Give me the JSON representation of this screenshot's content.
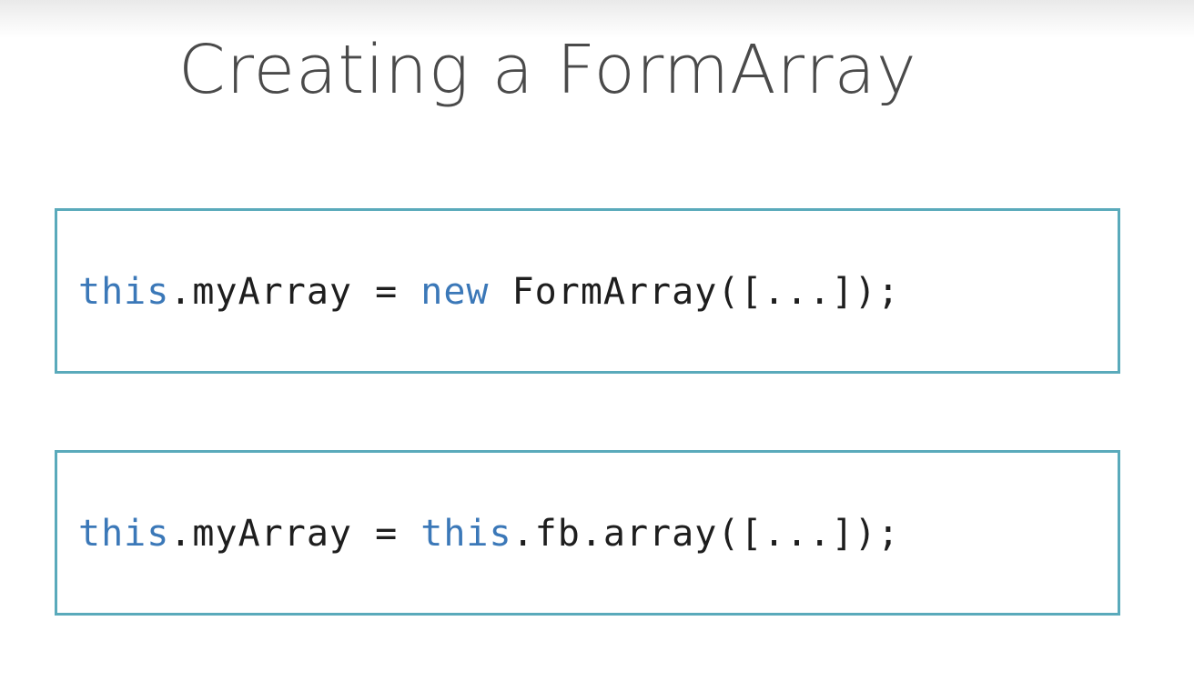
{
  "slide": {
    "title": "Creating a FormArray"
  },
  "snippets": [
    {
      "tokens": [
        {
          "text": "this",
          "type": "keyword"
        },
        {
          "text": ".myArray = ",
          "type": "plain"
        },
        {
          "text": "new",
          "type": "keyword"
        },
        {
          "text": " FormArray([...]);",
          "type": "plain"
        }
      ]
    },
    {
      "tokens": [
        {
          "text": "this",
          "type": "keyword"
        },
        {
          "text": ".myArray = ",
          "type": "plain"
        },
        {
          "text": "this",
          "type": "keyword"
        },
        {
          "text": ".fb.array([...]);",
          "type": "plain"
        }
      ]
    }
  ],
  "colors": {
    "keyword": "#3b78b8",
    "code_text": "#1e1e1e",
    "box_border": "#5aaabb",
    "title_text": "#4a4a4a"
  }
}
